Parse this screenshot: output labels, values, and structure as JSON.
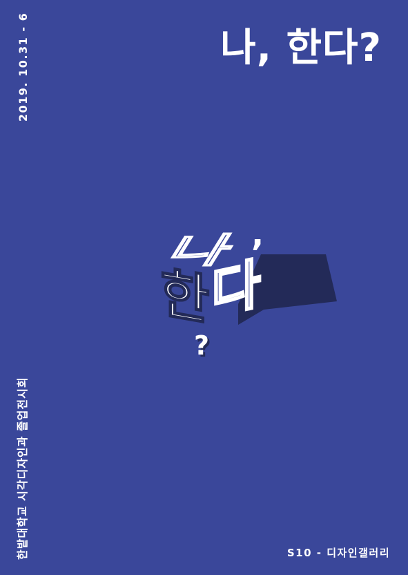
{
  "poster": {
    "title": "나, 한다?",
    "date": "2019. 10.31 - 6",
    "organization": "한밭대학교 시각디자인과 졸업전시회",
    "venue": "S10 - 디자인갤러리"
  },
  "logo": {
    "glyph_top": "나",
    "glyph_comma": ",",
    "glyph_left": "한",
    "glyph_right": "다",
    "glyph_question": "?"
  },
  "colors": {
    "background": "#3a479a",
    "text": "#ffffff",
    "shadow": "#232a58",
    "outline_face": "#3a479a"
  }
}
